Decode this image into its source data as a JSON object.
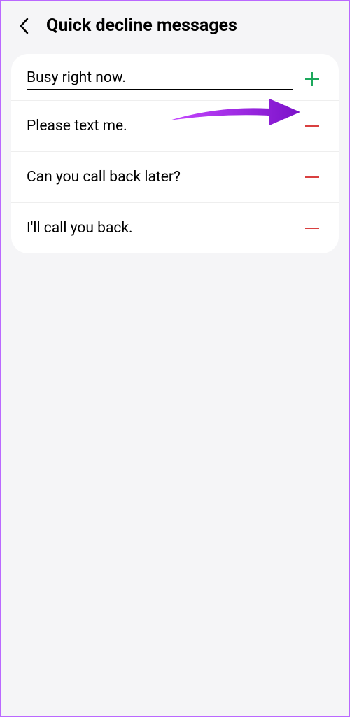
{
  "header": {
    "title": "Quick decline messages"
  },
  "input": {
    "value": "Busy right now."
  },
  "messages": [
    {
      "text": "Please text me."
    },
    {
      "text": "Can you call back later?"
    },
    {
      "text": "I'll call you back."
    }
  ],
  "colors": {
    "add": "#1ca85c",
    "remove": "#d94040",
    "annotation": "#9b1fe8"
  }
}
